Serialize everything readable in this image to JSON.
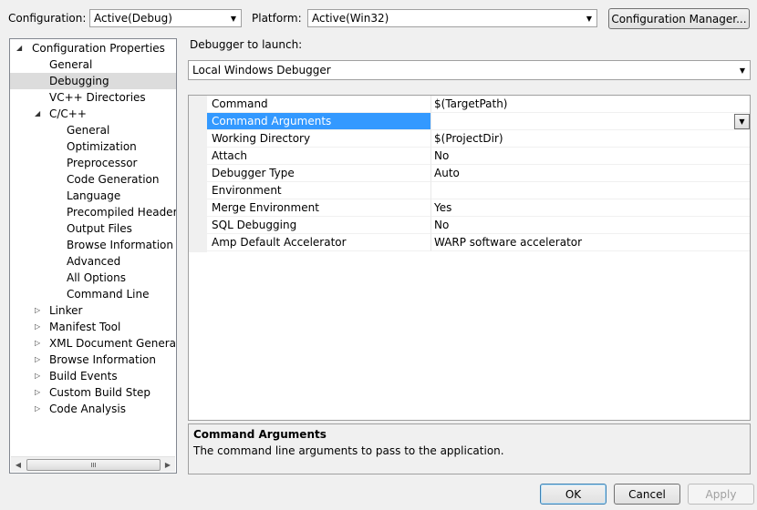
{
  "toolbar": {
    "configuration_label": "Configuration:",
    "configuration_value": "Active(Debug)",
    "platform_label": "Platform:",
    "platform_value": "Active(Win32)",
    "config_manager_button": "Configuration Manager..."
  },
  "tree": {
    "root": "Configuration Properties",
    "items": [
      {
        "label": "General"
      },
      {
        "label": "Debugging",
        "selected": true
      },
      {
        "label": "VC++ Directories"
      },
      {
        "label": "C/C++",
        "expanded": true
      },
      {
        "label": "General"
      },
      {
        "label": "Optimization"
      },
      {
        "label": "Preprocessor"
      },
      {
        "label": "Code Generation"
      },
      {
        "label": "Language"
      },
      {
        "label": "Precompiled Headers"
      },
      {
        "label": "Output Files"
      },
      {
        "label": "Browse Information"
      },
      {
        "label": "Advanced"
      },
      {
        "label": "All Options"
      },
      {
        "label": "Command Line"
      },
      {
        "label": "Linker"
      },
      {
        "label": "Manifest Tool"
      },
      {
        "label": "XML Document Generator"
      },
      {
        "label": "Browse Information"
      },
      {
        "label": "Build Events"
      },
      {
        "label": "Custom Build Step"
      },
      {
        "label": "Code Analysis"
      }
    ],
    "scroll_thumb_glyph": "III"
  },
  "debugger": {
    "label": "Debugger to launch:",
    "value": "Local Windows Debugger"
  },
  "properties": [
    {
      "name": "Command",
      "value": "$(TargetPath)"
    },
    {
      "name": "Command Arguments",
      "value": "",
      "selected": true
    },
    {
      "name": "Working Directory",
      "value": "$(ProjectDir)"
    },
    {
      "name": "Attach",
      "value": "No"
    },
    {
      "name": "Debugger Type",
      "value": "Auto"
    },
    {
      "name": "Environment",
      "value": ""
    },
    {
      "name": "Merge Environment",
      "value": "Yes"
    },
    {
      "name": "SQL Debugging",
      "value": "No"
    },
    {
      "name": "Amp Default Accelerator",
      "value": "WARP software accelerator"
    }
  ],
  "description": {
    "title": "Command Arguments",
    "text": "The command line arguments to pass to the application."
  },
  "buttons": {
    "ok": "OK",
    "cancel": "Cancel",
    "apply": "Apply"
  },
  "icons": {
    "dropdown": "chevron-down-icon",
    "tree_expanded": "triangle-expanded-icon",
    "tree_collapsed": "triangle-collapsed-icon"
  },
  "colors": {
    "selection": "#3399ff",
    "tree_selection": "#dcdcdc",
    "background": "#f0f0f0"
  }
}
